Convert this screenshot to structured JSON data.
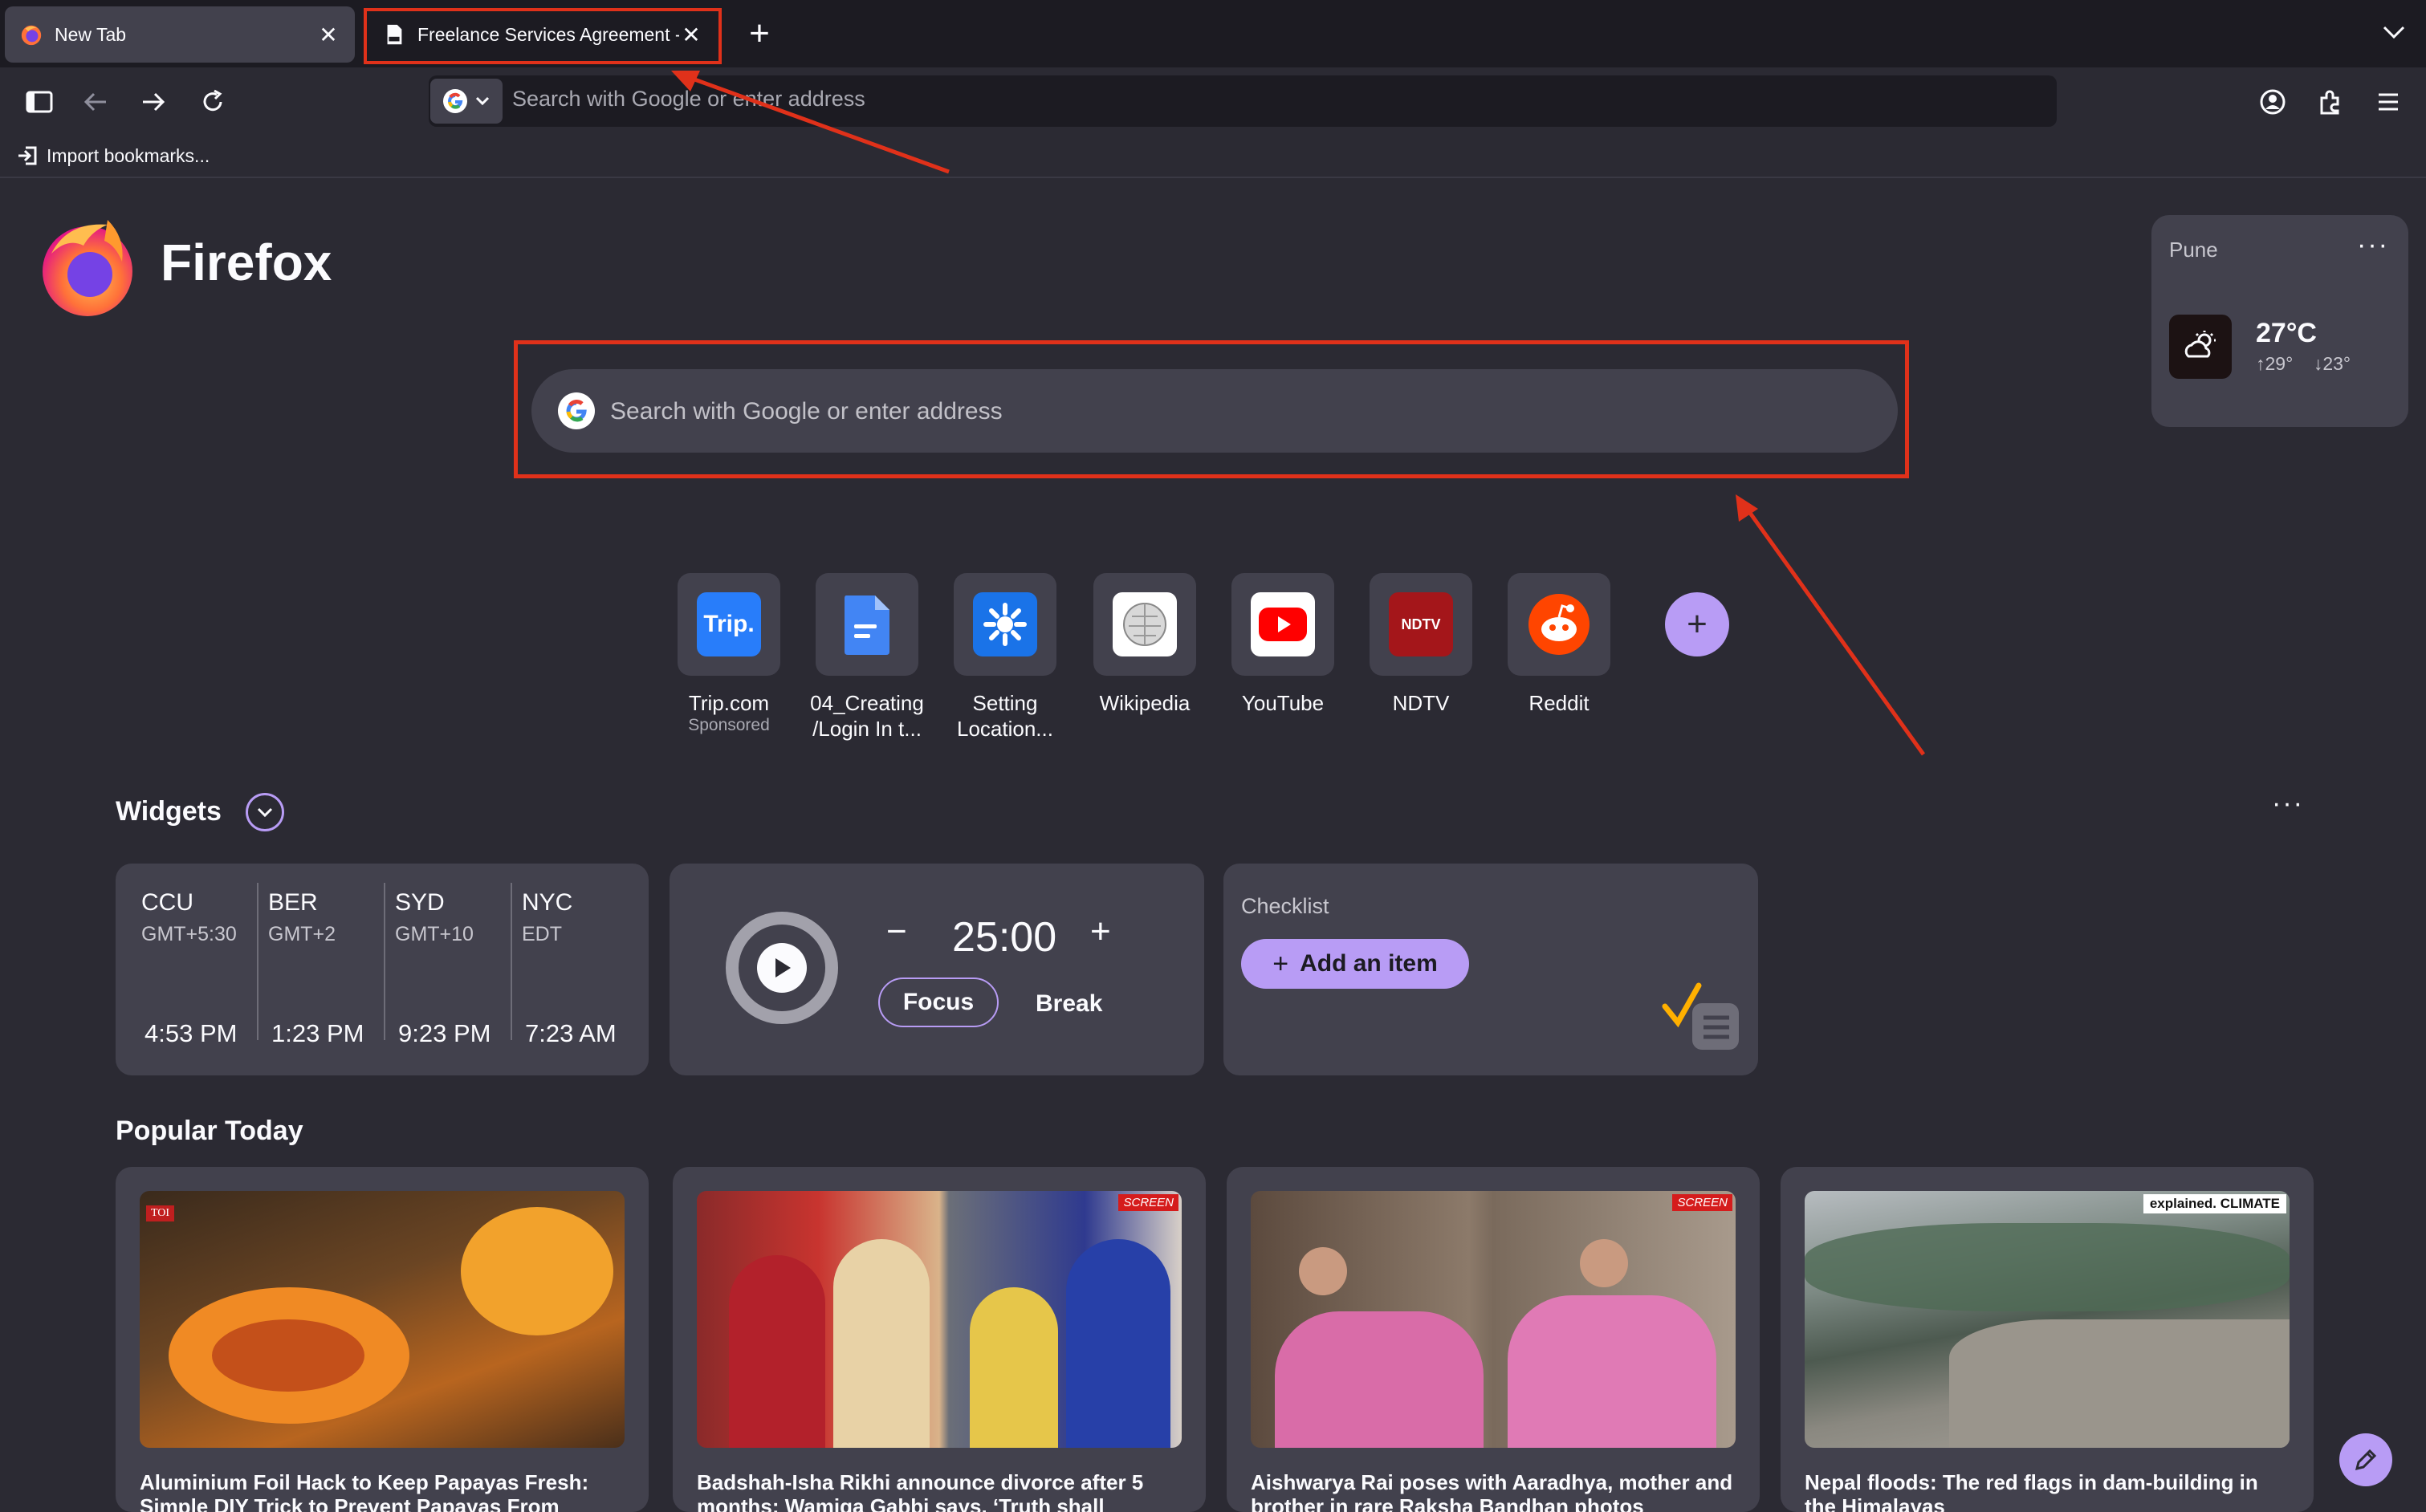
{
  "tabs": [
    {
      "label": "New Tab",
      "active": true
    },
    {
      "label": "Freelance Services Agreement -",
      "active": false
    }
  ],
  "toolbar": {
    "urlbar_placeholder": "Search with Google or enter address"
  },
  "bookmarks": {
    "import_label": "Import bookmarks..."
  },
  "brand": {
    "name": "Firefox"
  },
  "search": {
    "placeholder": "Search with Google or enter address"
  },
  "weather": {
    "city": "Pune",
    "temperature": "27°C",
    "high": "29°",
    "low": "23°",
    "menu": "···"
  },
  "shortcuts": [
    {
      "label": "Trip.com",
      "sub": "Sponsored",
      "icon": "trip-icon"
    },
    {
      "label": "04_Creating /Login In t...",
      "sub": "",
      "icon": "docs-icon"
    },
    {
      "label": "Setting Location...",
      "sub": "",
      "icon": "settings-gear-icon"
    },
    {
      "label": "Wikipedia",
      "sub": "",
      "icon": "wikipedia-icon"
    },
    {
      "label": "YouTube",
      "sub": "",
      "icon": "youtube-icon"
    },
    {
      "label": "NDTV",
      "sub": "",
      "icon": "ndtv-icon"
    },
    {
      "label": "Reddit",
      "sub": "",
      "icon": "reddit-icon"
    }
  ],
  "shortcut_icon_text": {
    "trip": "Trip.",
    "ndtv": "NDTV"
  },
  "widgets": {
    "title": "Widgets",
    "menu": "···",
    "clocks": [
      {
        "city": "CCU",
        "tz": "GMT+5:30",
        "time": "4:53 PM"
      },
      {
        "city": "BER",
        "tz": "GMT+2",
        "time": "1:23 PM"
      },
      {
        "city": "SYD",
        "tz": "GMT+10",
        "time": "9:23 PM"
      },
      {
        "city": "NYC",
        "tz": "EDT",
        "time": "7:23 AM"
      }
    ],
    "timer": {
      "value": "25:00",
      "minus": "−",
      "plus": "+",
      "focus_label": "Focus",
      "break_label": "Break"
    },
    "checklist": {
      "title": "Checklist",
      "add_label": "Add an item"
    }
  },
  "popular": {
    "title": "Popular Today",
    "stories": [
      {
        "headline": "Aluminium Foil Hack to Keep Papayas Fresh: Simple DIY Trick to Prevent Papayas From",
        "badge": "TOI"
      },
      {
        "headline": "Badshah-Isha Rikhi announce divorce after 5 months; Wamiqa Gabbi says, ‘Truth shall",
        "badge": "SCREEN"
      },
      {
        "headline": "Aishwarya Rai poses with Aaradhya, mother and brother in rare Raksha Bandhan photos",
        "badge": "SCREEN"
      },
      {
        "headline": "Nepal floods: The red flags in dam-building in the Himalayas",
        "badge": "explained. CLIMATE"
      }
    ]
  },
  "colors": {
    "background": "#2b2a33",
    "card": "#42414d",
    "accent": "#b89cf5",
    "annotation": "#e0311a"
  }
}
